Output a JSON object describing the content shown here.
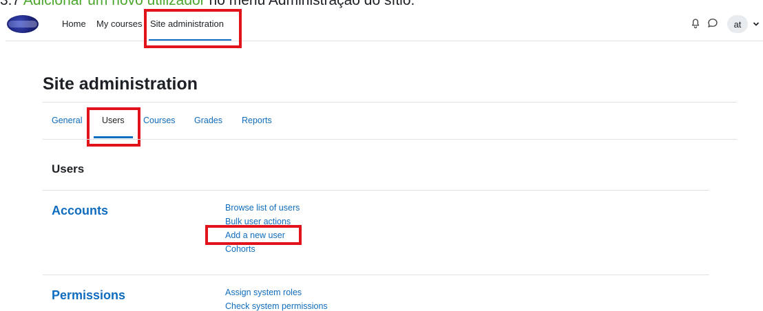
{
  "caption": {
    "prefix": "3.7 ",
    "highlight": "Adicionar um novo utilizador",
    "suffix": " no menu Administração do sítio."
  },
  "navbar": {
    "items": [
      {
        "label": "Home"
      },
      {
        "label": "My courses"
      },
      {
        "label": "Site administration",
        "active": true
      }
    ],
    "user_initials": "at",
    "icons": [
      "bell-icon",
      "chat-icon",
      "chevron-down-icon"
    ]
  },
  "page": {
    "title": "Site administration",
    "tabs": [
      {
        "label": "General"
      },
      {
        "label": "Users",
        "active": true
      },
      {
        "label": "Courses"
      },
      {
        "label": "Grades"
      },
      {
        "label": "Reports"
      }
    ],
    "section_title": "Users",
    "categories": [
      {
        "title": "Accounts",
        "links": [
          "Browse list of users",
          "Bulk user actions",
          "Add a new user",
          "Cohorts"
        ]
      },
      {
        "title": "Permissions",
        "links": [
          "Assign system roles",
          "Check system permissions"
        ]
      }
    ]
  },
  "colors": {
    "accent": "#0f6cbf",
    "highlight_box": "#e1121a",
    "caption_green": "#4ca72f"
  }
}
